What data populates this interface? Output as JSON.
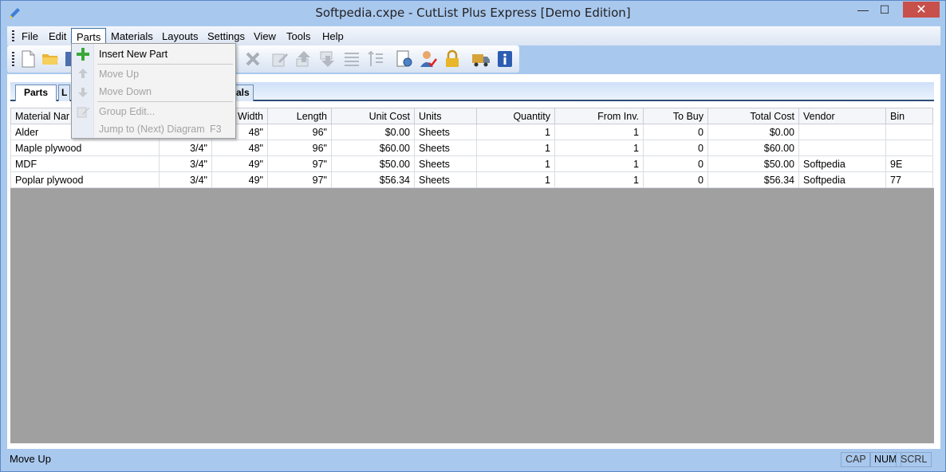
{
  "window": {
    "title": "Softpedia.cxpe - CutList Plus Express [Demo Edition]",
    "controls": {
      "minimize": "—",
      "maximize": "☐",
      "close": "✕"
    }
  },
  "menubar": {
    "items": [
      {
        "label": "File"
      },
      {
        "label": "Edit"
      },
      {
        "label": "Parts",
        "active": true
      },
      {
        "label": "Materials"
      },
      {
        "label": "Layouts"
      },
      {
        "label": "Settings"
      },
      {
        "label": "View"
      },
      {
        "label": "Tools"
      },
      {
        "label": "Help"
      }
    ]
  },
  "toolbar": {
    "icons": [
      "new-file-icon",
      "open-folder-icon",
      "save-icon",
      "delete-icon",
      "edit-icon",
      "move-up-icon",
      "move-down-icon",
      "list-icon",
      "sort-icon",
      "settings-doc-icon",
      "user-check-icon",
      "lock-icon",
      "truck-icon",
      "info-icon"
    ]
  },
  "tabs": [
    {
      "label": "Parts",
      "selected": true
    },
    {
      "label": "L"
    },
    {
      "label": "rials"
    }
  ],
  "grid": {
    "columns": [
      "Material Nar",
      "",
      "Width",
      "Length",
      "Unit Cost",
      "Units",
      "Quantity",
      "From Inv.",
      "To Buy",
      "Total Cost",
      "Vendor",
      "Bin"
    ],
    "rows": [
      [
        "Alder",
        "",
        "48\"",
        "96\"",
        "$0.00",
        "Sheets",
        "1",
        "1",
        "0",
        "$0.00",
        "",
        ""
      ],
      [
        "Maple plywood",
        "3/4\"",
        "48\"",
        "96\"",
        "$60.00",
        "Sheets",
        "1",
        "1",
        "0",
        "$60.00",
        "",
        ""
      ],
      [
        "MDF",
        "3/4\"",
        "49\"",
        "97\"",
        "$50.00",
        "Sheets",
        "1",
        "1",
        "0",
        "$50.00",
        "Softpedia",
        "9E"
      ],
      [
        "Poplar plywood",
        "3/4\"",
        "49\"",
        "97\"",
        "$56.34",
        "Sheets",
        "1",
        "1",
        "0",
        "$56.34",
        "Softpedia",
        "77"
      ]
    ]
  },
  "parts_menu": {
    "insert_new_part": "Insert New Part",
    "move_up": "Move Up",
    "move_down": "Move Down",
    "group_edit": "Group Edit...",
    "jump_to_diagram": "Jump to (Next) Diagram",
    "jump_shortcut": "F3"
  },
  "statusbar": {
    "text": "Move Up",
    "cap": "CAP",
    "num": "NUM",
    "scrl": "SCRL"
  }
}
